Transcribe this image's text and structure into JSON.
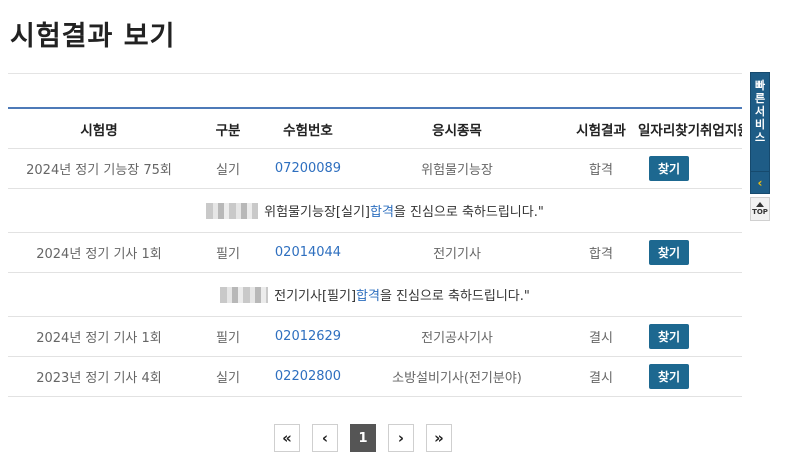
{
  "page": {
    "title": "시험결과 보기"
  },
  "table": {
    "headers": {
      "exam_name": "시험명",
      "type": "구분",
      "exam_number": "수험번호",
      "subject": "응시종목",
      "result": "시험결과",
      "job_search": "일자리찾기",
      "employment": "취업지원"
    },
    "rows": [
      {
        "exam_name": "2024년 정기 기능장 75회",
        "type": "실기",
        "exam_number": "07200089",
        "subject": "위험물기능장",
        "result": "합격",
        "job_button": "찾기"
      },
      {
        "exam_name": "2024년 정기 기사 1회",
        "type": "필기",
        "exam_number": "02014044",
        "subject": "전기기사",
        "result": "합격",
        "job_button": "찾기"
      },
      {
        "exam_name": "2024년 정기 기사 1회",
        "type": "필기",
        "exam_number": "02012629",
        "subject": "전기공사기사",
        "result": "결시",
        "job_button": "찾기"
      },
      {
        "exam_name": "2023년 정기 기사 4회",
        "type": "실기",
        "exam_number": "02202800",
        "subject": "소방설비기사(전기분야)",
        "result": "결시",
        "job_button": "찾기"
      }
    ],
    "messages": [
      {
        "pre": "위험물기능장[실기] ",
        "pass": "합격",
        "post": "을 진심으로 축하드립니다.\""
      },
      {
        "pre": "전기기사[필기] ",
        "pass": "합격",
        "post": "을 진심으로 축하드립니다.\""
      }
    ]
  },
  "pagination": {
    "first": "«",
    "prev": "‹",
    "current": "1",
    "next": "›",
    "last": "»"
  },
  "quick": {
    "label_chars": [
      "빠",
      "른",
      "서",
      "비",
      "스"
    ],
    "arrow": "‹",
    "top": "TOP"
  }
}
